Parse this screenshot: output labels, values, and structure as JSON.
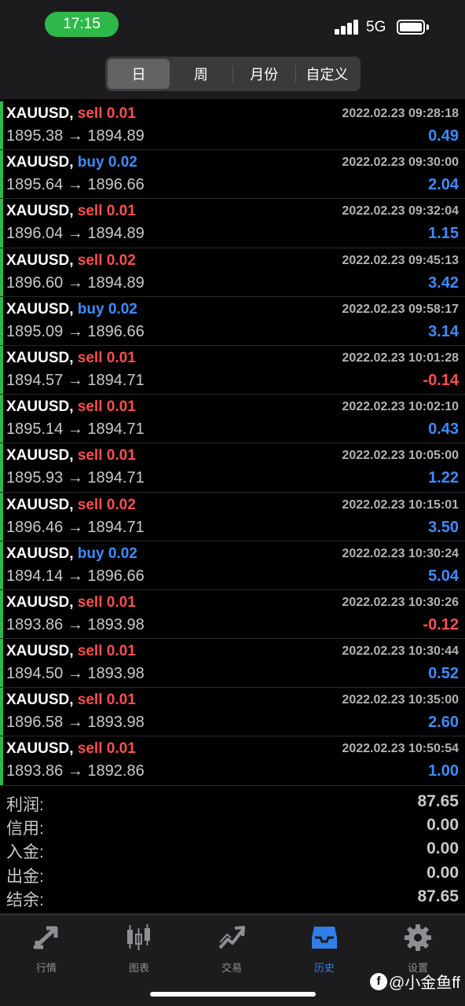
{
  "status_bar": {
    "time": "17:15",
    "network": "5G"
  },
  "tabs": [
    {
      "label": "日",
      "active": true
    },
    {
      "label": "周",
      "active": false
    },
    {
      "label": "月份",
      "active": false
    },
    {
      "label": "自定义",
      "active": false
    }
  ],
  "trades": [
    {
      "symbol": "XAUUSD,",
      "side": "sell",
      "lots": "0.01",
      "time": "2022.02.23 09:28:18",
      "open": "1895.38",
      "close": "1894.89",
      "arrow": "→",
      "profit": "0.49"
    },
    {
      "symbol": "XAUUSD,",
      "side": "buy",
      "lots": "0.02",
      "time": "2022.02.23 09:30:00",
      "open": "1895.64",
      "close": "1896.66",
      "arrow": "→",
      "profit": "2.04"
    },
    {
      "symbol": "XAUUSD,",
      "side": "sell",
      "lots": "0.01",
      "time": "2022.02.23 09:32:04",
      "open": "1896.04",
      "close": "1894.89",
      "arrow": "→",
      "profit": "1.15"
    },
    {
      "symbol": "XAUUSD,",
      "side": "sell",
      "lots": "0.02",
      "time": "2022.02.23 09:45:13",
      "open": "1896.60",
      "close": "1894.89",
      "arrow": "→",
      "profit": "3.42"
    },
    {
      "symbol": "XAUUSD,",
      "side": "buy",
      "lots": "0.02",
      "time": "2022.02.23 09:58:17",
      "open": "1895.09",
      "close": "1896.66",
      "arrow": "→",
      "profit": "3.14"
    },
    {
      "symbol": "XAUUSD,",
      "side": "sell",
      "lots": "0.01",
      "time": "2022.02.23 10:01:28",
      "open": "1894.57",
      "close": "1894.71",
      "arrow": "→",
      "profit": "-0.14"
    },
    {
      "symbol": "XAUUSD,",
      "side": "sell",
      "lots": "0.01",
      "time": "2022.02.23 10:02:10",
      "open": "1895.14",
      "close": "1894.71",
      "arrow": "→",
      "profit": "0.43"
    },
    {
      "symbol": "XAUUSD,",
      "side": "sell",
      "lots": "0.01",
      "time": "2022.02.23 10:05:00",
      "open": "1895.93",
      "close": "1894.71",
      "arrow": "→",
      "profit": "1.22"
    },
    {
      "symbol": "XAUUSD,",
      "side": "sell",
      "lots": "0.02",
      "time": "2022.02.23 10:15:01",
      "open": "1896.46",
      "close": "1894.71",
      "arrow": "→",
      "profit": "3.50"
    },
    {
      "symbol": "XAUUSD,",
      "side": "buy",
      "lots": "0.02",
      "time": "2022.02.23 10:30:24",
      "open": "1894.14",
      "close": "1896.66",
      "arrow": "→",
      "profit": "5.04"
    },
    {
      "symbol": "XAUUSD,",
      "side": "sell",
      "lots": "0.01",
      "time": "2022.02.23 10:30:26",
      "open": "1893.86",
      "close": "1893.98",
      "arrow": "→",
      "profit": "-0.12"
    },
    {
      "symbol": "XAUUSD,",
      "side": "sell",
      "lots": "0.01",
      "time": "2022.02.23 10:30:44",
      "open": "1894.50",
      "close": "1893.98",
      "arrow": "→",
      "profit": "0.52"
    },
    {
      "symbol": "XAUUSD,",
      "side": "sell",
      "lots": "0.01",
      "time": "2022.02.23 10:35:00",
      "open": "1896.58",
      "close": "1893.98",
      "arrow": "→",
      "profit": "2.60"
    },
    {
      "symbol": "XAUUSD,",
      "side": "sell",
      "lots": "0.01",
      "time": "2022.02.23 10:50:54",
      "open": "1893.86",
      "close": "1892.86",
      "arrow": "→",
      "profit": "1.00"
    }
  ],
  "summary": [
    {
      "label": "利润:",
      "value": "87.65"
    },
    {
      "label": "信用:",
      "value": "0.00"
    },
    {
      "label": "入金:",
      "value": "0.00"
    },
    {
      "label": "出金:",
      "value": "0.00"
    },
    {
      "label": "结余:",
      "value": "87.65"
    }
  ],
  "tabbar": [
    {
      "label": "行情",
      "icon": "quotes-icon",
      "active": false
    },
    {
      "label": "图表",
      "icon": "chart-icon",
      "active": false
    },
    {
      "label": "交易",
      "icon": "trade-icon",
      "active": false
    },
    {
      "label": "历史",
      "icon": "history-icon",
      "active": true
    },
    {
      "label": "设置",
      "icon": "settings-icon",
      "active": false
    }
  ],
  "watermark": {
    "logo": "f",
    "text": "@小金鱼ff"
  },
  "colors": {
    "sell": "#ff4d4d",
    "buy": "#3b8cff",
    "accent": "#2fb84a",
    "active_tab": "#2f7fe6"
  }
}
